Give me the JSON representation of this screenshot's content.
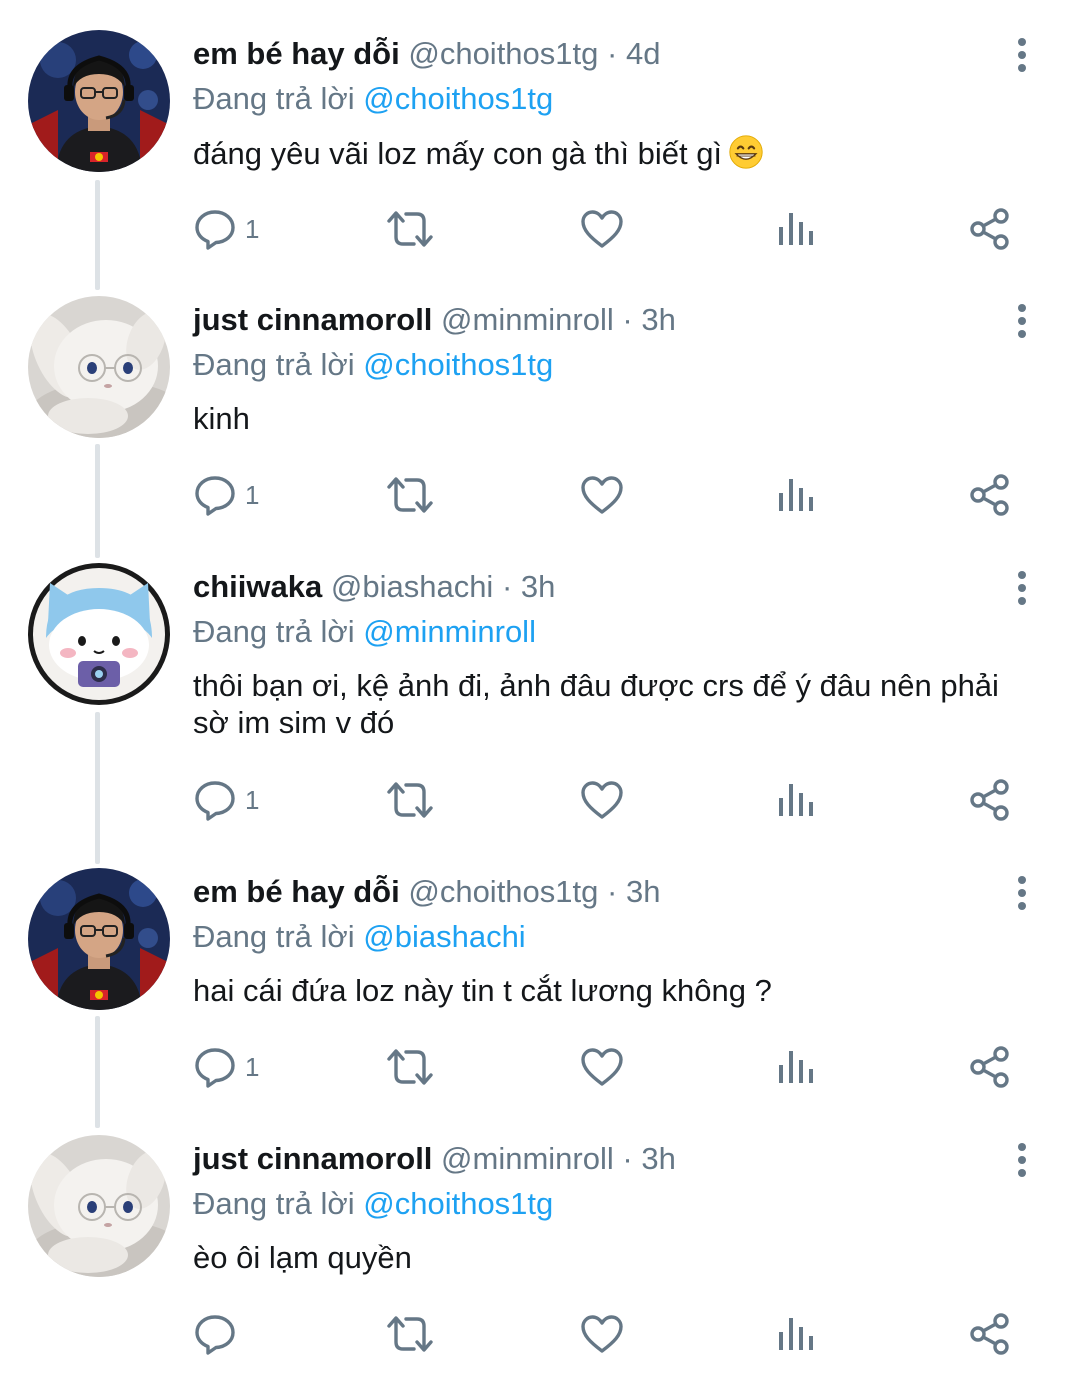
{
  "tweets": [
    {
      "display_name": "em bé hay dỗi",
      "handle": "@choithos1tg",
      "separator": "·",
      "time": "4d",
      "reply_prefix": "Đang trả lời",
      "reply_to": "@choithos1tg",
      "text": "đáng yêu vãi loz mấy con gà thì biết gì",
      "emoji": "grinning-face-emoji",
      "reply_count": "1",
      "avatar": "streamer-avatar"
    },
    {
      "display_name": "just cinnamoroll",
      "handle": "@minminroll",
      "separator": "·",
      "time": "3h",
      "reply_prefix": "Đang trả lời",
      "reply_to": "@choithos1tg",
      "text": "kinh",
      "reply_count": "1",
      "avatar": "plush-avatar"
    },
    {
      "display_name": "chiiwaka",
      "handle": "@biashachi",
      "separator": "·",
      "time": "3h",
      "reply_prefix": "Đang trả lời",
      "reply_to": "@minminroll",
      "text_line1": "thôi bạn ơi, kệ ảnh đi, ảnh đâu được crs để ý đâu nên phải",
      "text_line2": "sờ im sim v đó",
      "reply_count": "1",
      "avatar": "cartoon-cat-avatar"
    },
    {
      "display_name": "em bé hay dỗi",
      "handle": "@choithos1tg",
      "separator": "·",
      "time": "3h",
      "reply_prefix": "Đang trả lời",
      "reply_to": "@biashachi",
      "text": "hai cái đứa loz này tin t cắt lương không ?",
      "reply_count": "1",
      "avatar": "streamer-avatar"
    },
    {
      "display_name": "just cinnamoroll",
      "handle": "@minminroll",
      "separator": "·",
      "time": "3h",
      "reply_prefix": "Đang trả lời",
      "reply_to": "@choithos1tg",
      "text": "èo ôi lạm quyền",
      "reply_count": "",
      "avatar": "plush-avatar"
    }
  ],
  "colors": {
    "link": "#1da1f2",
    "secondary_text": "#657786",
    "primary_text": "#14171a",
    "thread_line": "#dde2e6"
  },
  "icons": [
    "reply-icon",
    "retweet-icon",
    "like-icon",
    "analytics-icon",
    "share-icon",
    "more-options-icon"
  ]
}
